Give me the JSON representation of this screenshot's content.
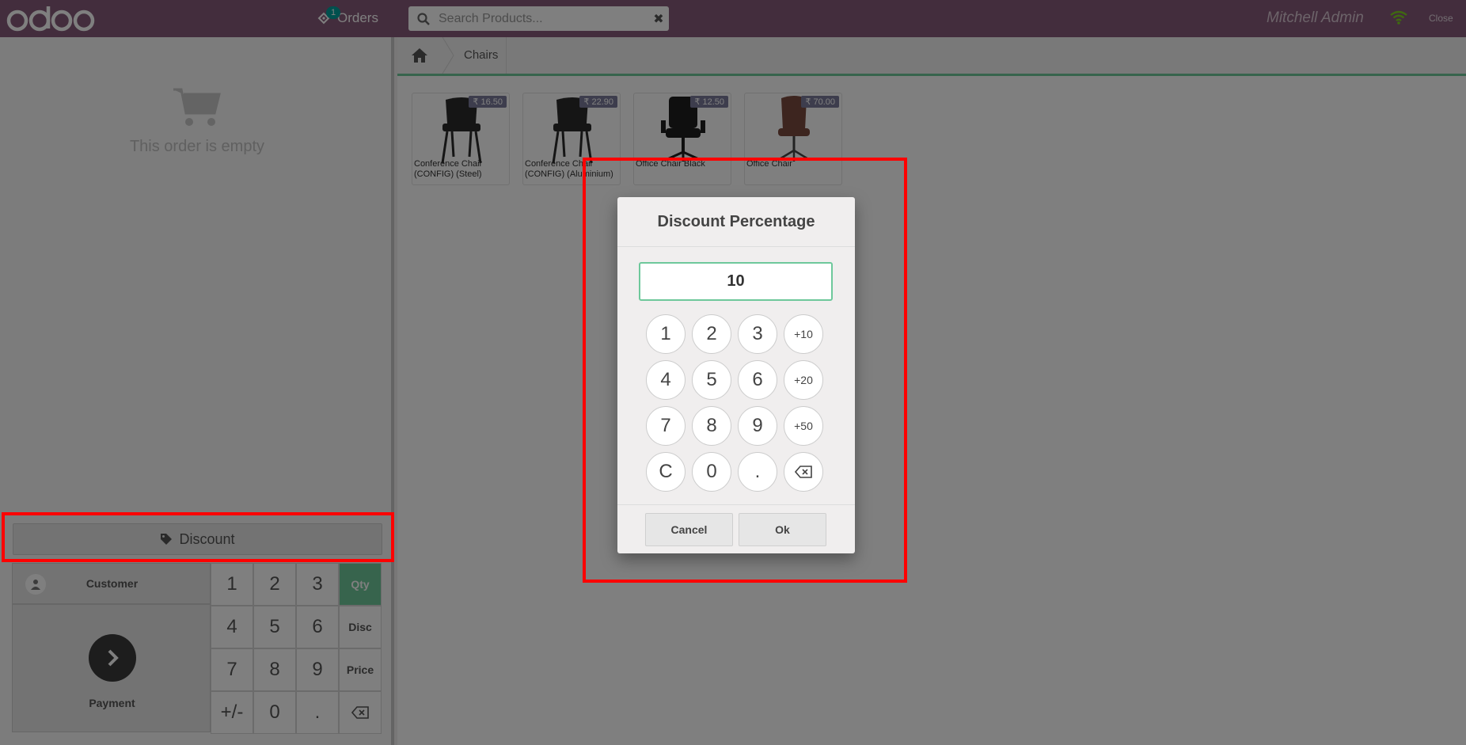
{
  "topbar": {
    "brand": "odoo",
    "orders_label": "Orders",
    "orders_count": "1",
    "search_placeholder": "Search Products...",
    "user_name": "Mitchell Admin",
    "close_label": "Close"
  },
  "order": {
    "empty_text": "This order is empty"
  },
  "actions": {
    "discount_label": "Discount"
  },
  "control": {
    "customer_label": "Customer",
    "payment_label": "Payment",
    "keys": [
      "1",
      "2",
      "3",
      "Qty",
      "4",
      "5",
      "6",
      "Disc",
      "7",
      "8",
      "9",
      "Price",
      "+/-",
      "0",
      "."
    ],
    "active_mode": "Qty"
  },
  "breadcrumb": {
    "category": "Chairs"
  },
  "products": [
    {
      "name": "Conference Chair (CONFIG) (Steel)",
      "price": "₹ 16.50",
      "color": "#2b2b2b"
    },
    {
      "name": "Conference Chair (CONFIG) (Aluminium)",
      "price": "₹ 22.90",
      "color": "#2b2b2b"
    },
    {
      "name": "Office Chair Black",
      "price": "₹ 12.50",
      "color": "#1e1e1e"
    },
    {
      "name": "Office Chair",
      "price": "₹ 70.00",
      "color": "#7a4a3e"
    }
  ],
  "popup": {
    "title": "Discount Percentage",
    "value": "10",
    "keys": [
      "1",
      "2",
      "3",
      "+10",
      "4",
      "5",
      "6",
      "+20",
      "7",
      "8",
      "9",
      "+50",
      "C",
      "0",
      "."
    ],
    "cancel_label": "Cancel",
    "ok_label": "Ok"
  },
  "colors": {
    "topbar": "#875a7b",
    "accent": "#6ec89b",
    "highlight": "#ff0000"
  }
}
